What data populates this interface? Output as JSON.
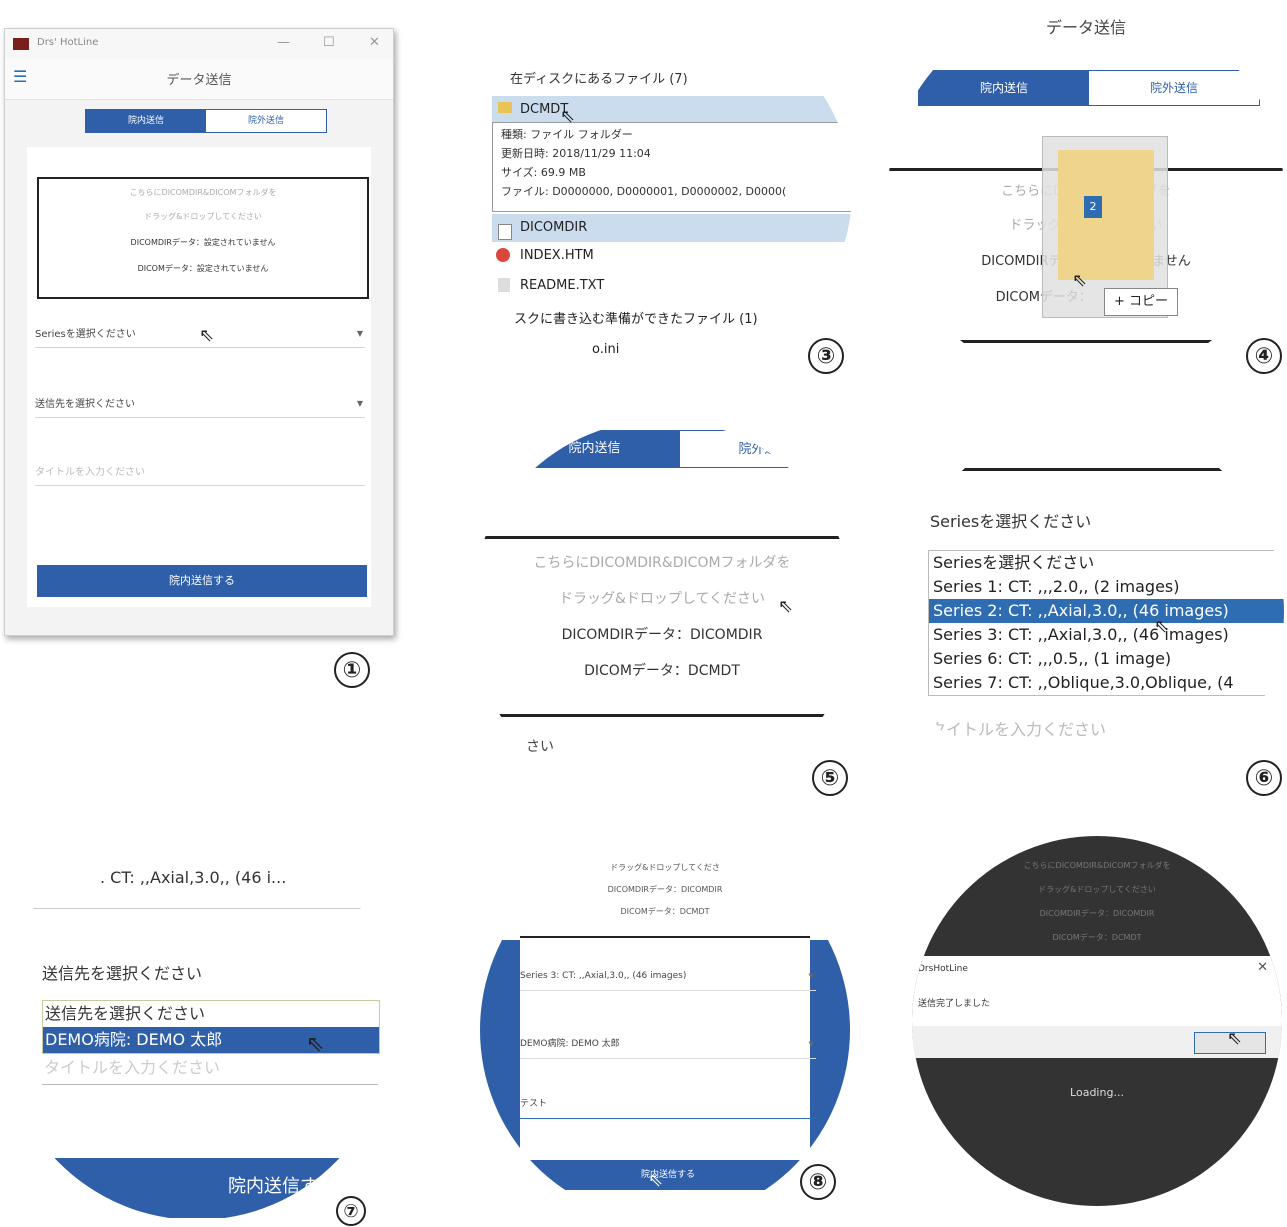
{
  "panel1": {
    "app_title": "Drs' HotLine",
    "window_controls": [
      "—",
      "☐",
      "✕"
    ],
    "header_title": "データ送信",
    "tabs": [
      "院内送信",
      "院外送信"
    ],
    "drop_lines": [
      "こちらにDICOMDIR&DICOMフォルダを",
      "ドラッグ&ドロップしてください",
      "DICOMDIRデータ：設定されていません",
      "DICOMデータ：設定されていません"
    ],
    "series_select": "Seriesを選択ください",
    "dest_select": "送信先を選択ください",
    "title_placeholder": "タイトルを入力ください",
    "send_button": "院内送信する",
    "number": "①"
  },
  "panel3": {
    "header": "在ディスクにあるファイル (7)",
    "folder": "DCMDT",
    "tooltip": [
      "種類: ファイル フォルダー",
      "更新日時: 2018/11/29 11:04",
      "サイズ: 69.9 MB",
      "ファイル: D0000000, D0000001, D0000002, D0000("
    ],
    "files": [
      "DICOMDIR",
      "INDEX.HTM",
      "README.TXT"
    ],
    "pending": "スクに書き込む準備ができたファイル (1)",
    "ini": "o.ini",
    "number": "③"
  },
  "panel4": {
    "title": "データ送信",
    "tabs": [
      "院内送信",
      "院外送信"
    ],
    "lines": [
      "こちらにDICO M フォルダを",
      "ドラッグ&　　　ください",
      "DICOMDIRデー　　されていません",
      "DICOMデータ：　　　　　せん"
    ],
    "badge": "2",
    "copy": "+ コピー",
    "number": "④"
  },
  "panel5": {
    "tabs": [
      "院内送信",
      "院外送信"
    ],
    "lines": [
      "こちらにDICOMDIR&DICOMフォルダを",
      "ドラッグ&ドロップしてください",
      "DICOMDIRデータ：DICOMDIR",
      "DICOMデータ：DCMDT"
    ],
    "bottom": "さい",
    "number": "⑤"
  },
  "panel6": {
    "label": "Seriesを選択ください",
    "options": [
      "Seriesを選択ください",
      "Series 1: CT: ,,,2.0,, (2 images)",
      "Series 2: CT: ,,Axial,3.0,, (46 images)",
      "Series 3: CT: ,,Axial,3.0,, (46 images)",
      "Series 6: CT: ,,,0.5,, (1 image)",
      "Series 7: CT: ,,Oblique,3.0,Oblique, (4"
    ],
    "selected_index": 2,
    "placeholder": "タイトルを入力ください",
    "number": "⑥"
  },
  "panel7": {
    "top": ". CT: ,,Axial,3.0,, (46 i...",
    "label": "送信先を選択ください",
    "options": [
      "送信先を選択ください",
      "DEMO病院: DEMO 太郎"
    ],
    "selected_index": 1,
    "placeholder": "タイトルを入力ください",
    "button": "院内送信する",
    "number": "⑦"
  },
  "panel8": {
    "lines": [
      "ドラッグ&ドロップしてくださ",
      "DICOMDIRデータ：DICOMDIR",
      "DICOMデータ：DCMDT"
    ],
    "series": "Series 3: CT: ,,Axial,3.0,, (46 images)",
    "dest": "DEMO病院: DEMO 太郎",
    "title": "テスト",
    "button": "院内送信する",
    "number": "⑧"
  },
  "panel9": {
    "dim_lines": [
      "こちらにDICOMDIR&DICOMフォルダを",
      "ドラッグ&ドロップしてください",
      "DICOMDIRデータ：DICOMDIR",
      "DICOMデータ：DCMDT"
    ],
    "dialog_title": "DrsHotLine",
    "close": "✕",
    "message": "送信完了しました",
    "loading": "Loading..."
  }
}
